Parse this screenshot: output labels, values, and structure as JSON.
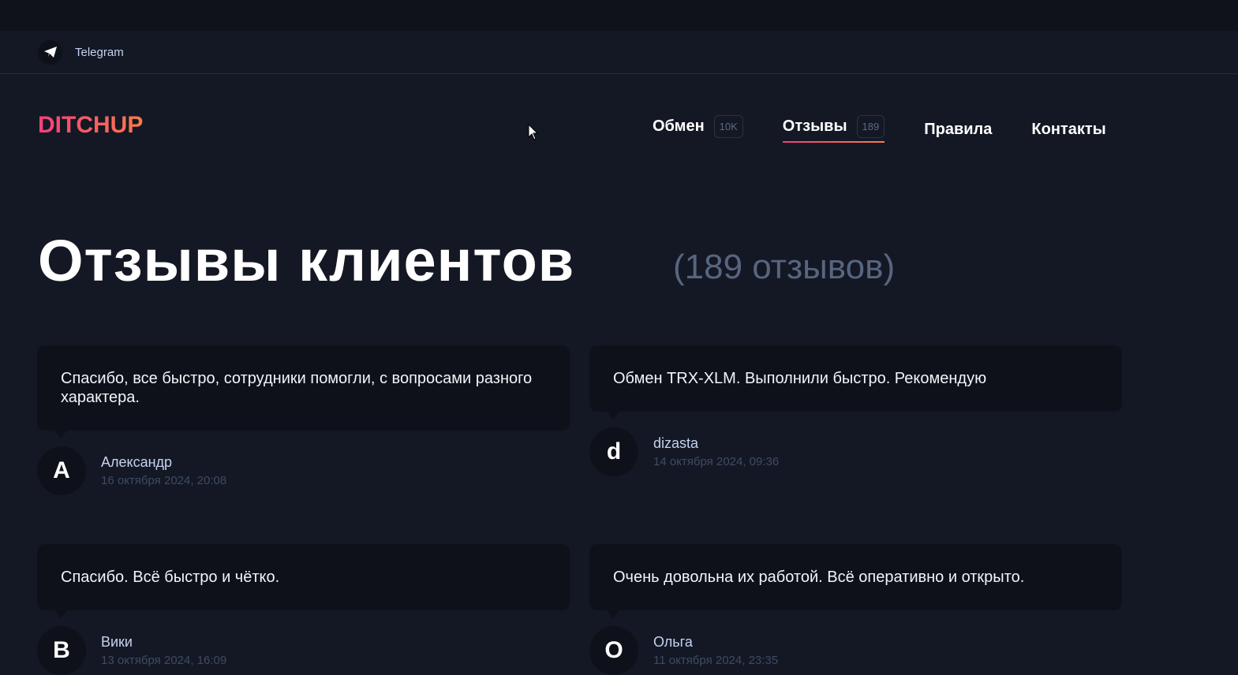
{
  "topbar": {
    "telegram_label": "Telegram"
  },
  "header": {
    "logo": "DITCHUP",
    "nav": [
      {
        "label": "Обмен",
        "badge": "10K"
      },
      {
        "label": "Отзывы",
        "badge": "189",
        "active": true
      },
      {
        "label": "Правила"
      },
      {
        "label": "Контакты"
      }
    ]
  },
  "page": {
    "title": "Отзывы клиентов",
    "count": "(189 отзывов)"
  },
  "reviews": [
    {
      "text": "Спасибо, все быстро, сотрудники помогли, с вопросами разного характера.",
      "initial": "A",
      "name": "Александр",
      "date": "16 октября 2024, 20:08"
    },
    {
      "text": "Обмен TRX-XLM. Выполнили быстро. Рекомендую",
      "initial": "d",
      "name": "dizasta",
      "date": "14 октября 2024, 09:36"
    },
    {
      "text": "Спасибо. Всё быстро и чётко.",
      "initial": "B",
      "name": "Вики",
      "date": "13 октября 2024, 16:09"
    },
    {
      "text": "Очень довольна их работой. Всё оперативно и открыто.",
      "initial": "O",
      "name": "Ольга",
      "date": "11 октября 2024, 23:35"
    }
  ]
}
